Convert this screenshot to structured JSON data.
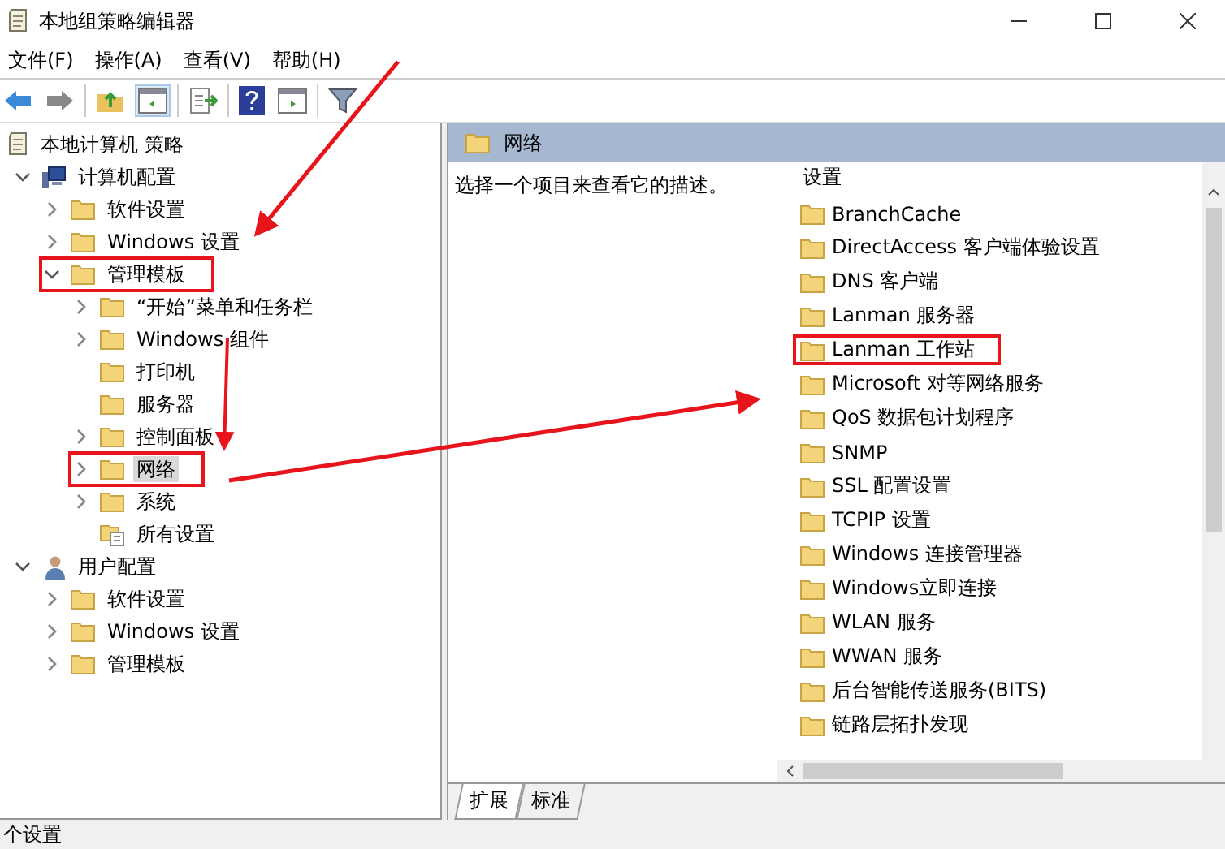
{
  "window": {
    "title": "本地组策略编辑器"
  },
  "menu": [
    "文件(F)",
    "操作(A)",
    "查看(V)",
    "帮助(H)"
  ],
  "tree": [
    {
      "label": "本地计算机 策略",
      "kind": "policy",
      "selected": false,
      "highlighted": false,
      "children": [
        {
          "label": "计算机配置",
          "kind": "computer",
          "expanded": true,
          "selected": false,
          "highlighted": false,
          "children": [
            {
              "label": "软件设置",
              "kind": "folder",
              "expanded": false,
              "selected": false,
              "highlighted": false
            },
            {
              "label": "Windows 设置",
              "kind": "folder",
              "expanded": false,
              "selected": false,
              "highlighted": false
            },
            {
              "label": "管理模板",
              "kind": "folder",
              "expanded": true,
              "selected": false,
              "highlighted": true,
              "children": [
                {
                  "label": "“开始”菜单和任务栏",
                  "kind": "folder",
                  "expanded": false,
                  "selected": false,
                  "highlighted": false
                },
                {
                  "label": "Windows 组件",
                  "kind": "folder",
                  "expanded": false,
                  "selected": false,
                  "highlighted": false
                },
                {
                  "label": "打印机",
                  "kind": "leaf",
                  "expanded": false,
                  "selected": false,
                  "highlighted": false
                },
                {
                  "label": "服务器",
                  "kind": "leaf",
                  "expanded": false,
                  "selected": false,
                  "highlighted": false
                },
                {
                  "label": "控制面板",
                  "kind": "folder",
                  "expanded": false,
                  "selected": false,
                  "highlighted": false
                },
                {
                  "label": "网络",
                  "kind": "folder",
                  "expanded": false,
                  "selected": true,
                  "highlighted": true
                },
                {
                  "label": "系统",
                  "kind": "folder",
                  "expanded": false,
                  "selected": false,
                  "highlighted": false
                },
                {
                  "label": "所有设置",
                  "kind": "settings",
                  "expanded": false,
                  "selected": false,
                  "highlighted": false
                }
              ]
            }
          ]
        },
        {
          "label": "用户配置",
          "kind": "user",
          "expanded": true,
          "selected": false,
          "highlighted": false,
          "children": [
            {
              "label": "软件设置",
              "kind": "folder",
              "expanded": false,
              "selected": false,
              "highlighted": false
            },
            {
              "label": "Windows 设置",
              "kind": "folder",
              "expanded": false,
              "selected": false,
              "highlighted": false
            },
            {
              "label": "管理模板",
              "kind": "folder",
              "expanded": false,
              "selected": false,
              "highlighted": false
            }
          ]
        }
      ]
    }
  ],
  "detail": {
    "title": "网络",
    "description": "选择一个项目来查看它的描述。",
    "column_header": "设置",
    "items": [
      {
        "label": "BranchCache",
        "highlighted": false
      },
      {
        "label": "DirectAccess 客户端体验设置",
        "highlighted": false
      },
      {
        "label": "DNS 客户端",
        "highlighted": false
      },
      {
        "label": "Lanman 服务器",
        "highlighted": false
      },
      {
        "label": "Lanman 工作站",
        "highlighted": true
      },
      {
        "label": "Microsoft 对等网络服务",
        "highlighted": false
      },
      {
        "label": "QoS 数据包计划程序",
        "highlighted": false
      },
      {
        "label": "SNMP",
        "highlighted": false
      },
      {
        "label": "SSL 配置设置",
        "highlighted": false
      },
      {
        "label": "TCPIP 设置",
        "highlighted": false
      },
      {
        "label": "Windows 连接管理器",
        "highlighted": false
      },
      {
        "label": "Windows立即连接",
        "highlighted": false
      },
      {
        "label": "WLAN 服务",
        "highlighted": false
      },
      {
        "label": "WWAN 服务",
        "highlighted": false
      },
      {
        "label": "后台智能传送服务(BITS)",
        "highlighted": false
      },
      {
        "label": "链路层拓扑发现",
        "highlighted": false
      }
    ],
    "tabs": [
      {
        "label": "扩展",
        "selected": true
      },
      {
        "label": "标准",
        "selected": false
      }
    ]
  },
  "status_bar": "个设置"
}
